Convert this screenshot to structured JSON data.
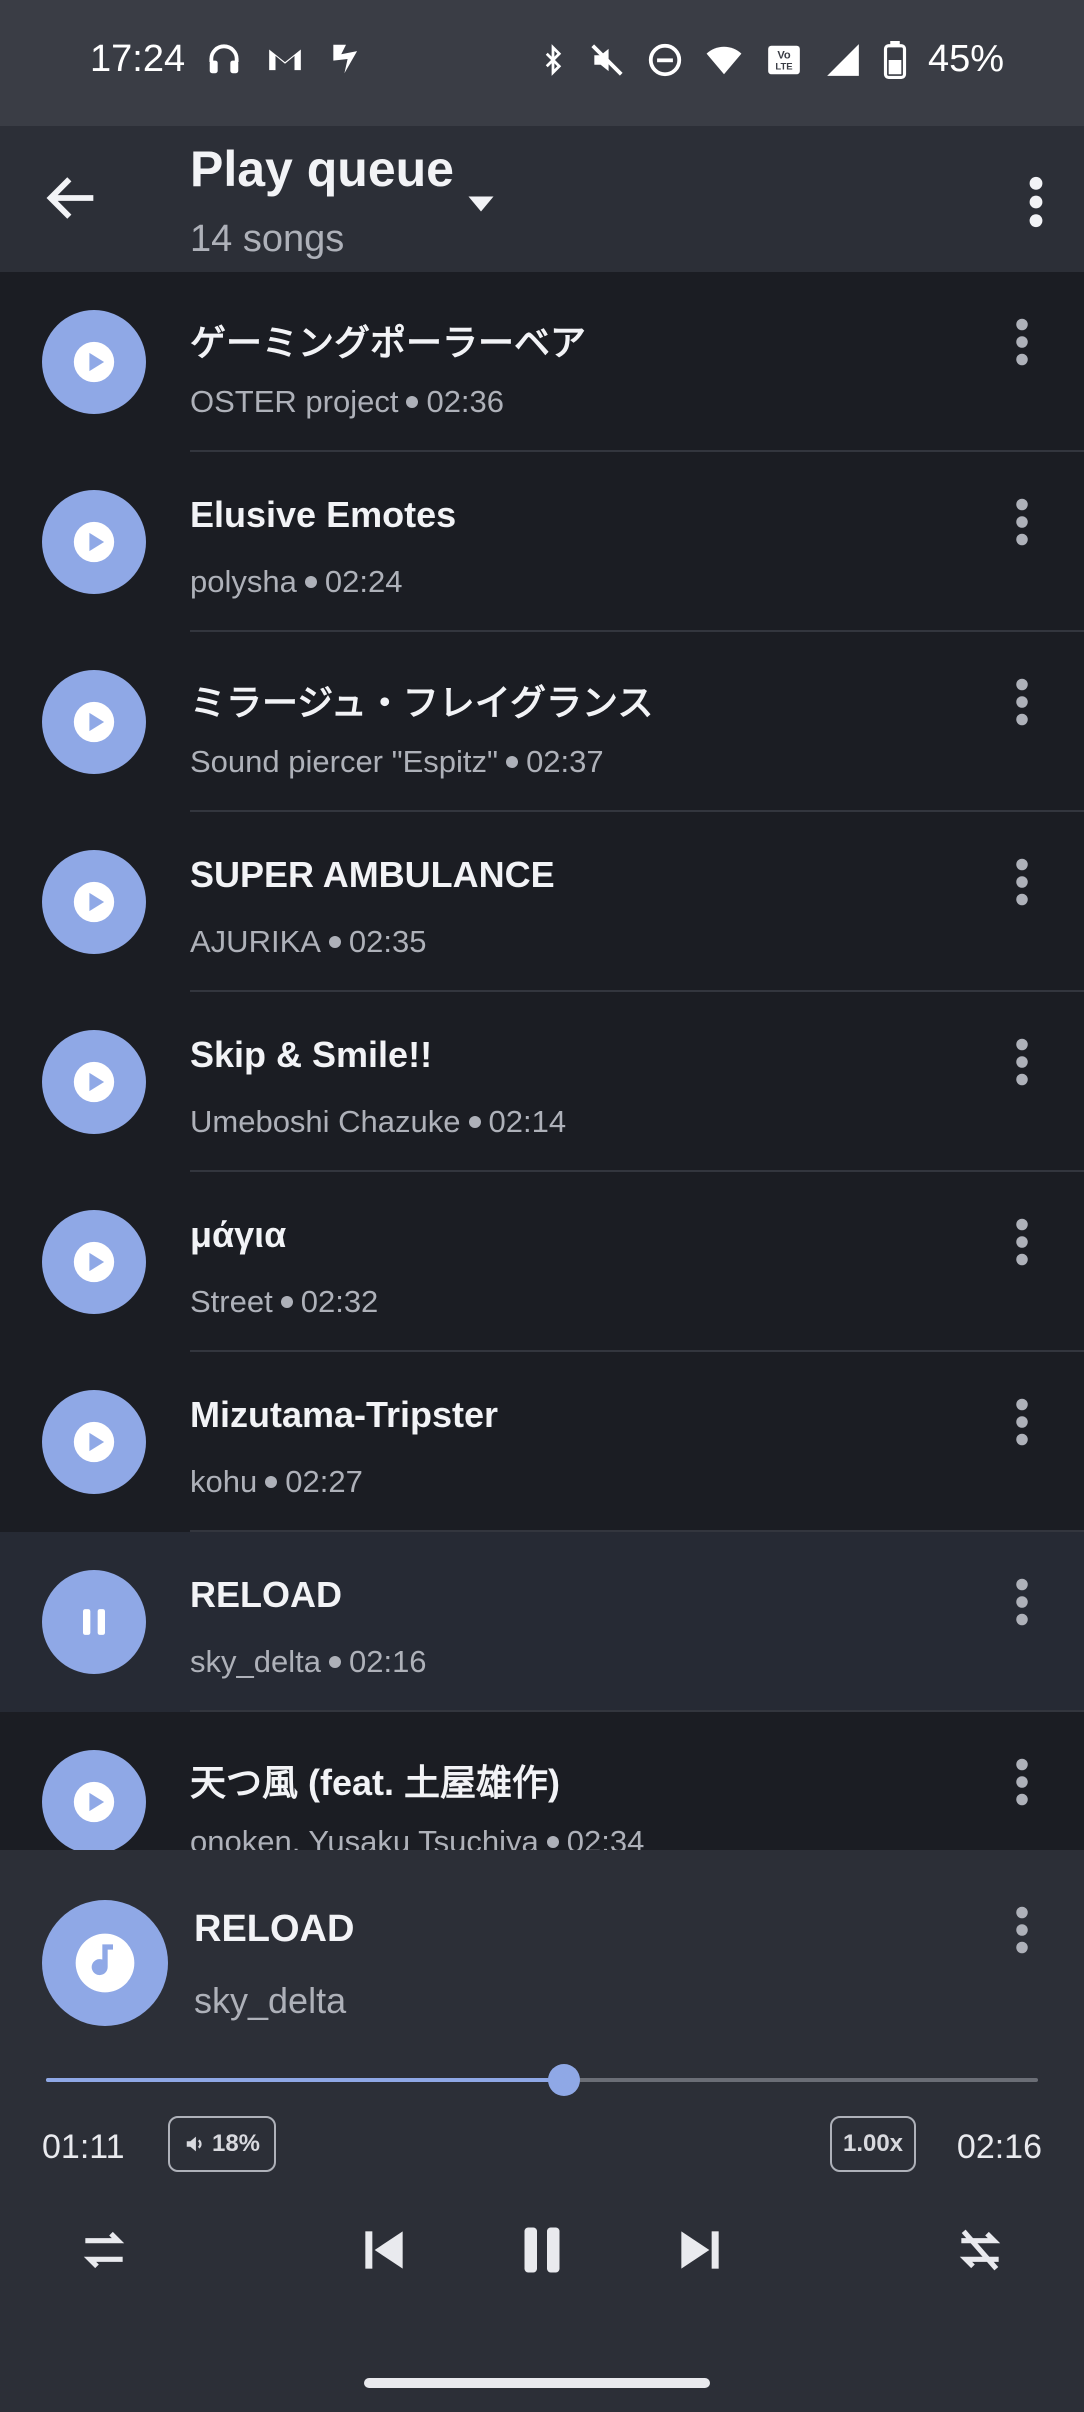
{
  "status_bar": {
    "time": "17:24",
    "battery": "45%",
    "left_icons": [
      "headphones-icon",
      "gmail-icon",
      "ticktick-icon"
    ],
    "right_icons": [
      "bluetooth-icon",
      "mute-icon",
      "dnd-icon",
      "wifi-icon",
      "volte-icon",
      "signal-icon",
      "battery-icon"
    ]
  },
  "app_bar": {
    "title": "Play queue",
    "subtitle": "14 songs"
  },
  "queue": [
    {
      "title": "ゲーミングポーラーベア",
      "artist": "OSTER project",
      "duration": "02:36",
      "state": "play"
    },
    {
      "title": "Elusive Emotes",
      "artist": "polysha",
      "duration": "02:24",
      "state": "play"
    },
    {
      "title": "ミラージュ・フレイグランス",
      "artist": "Sound piercer \"Espitz\"",
      "duration": "02:37",
      "state": "play"
    },
    {
      "title": "SUPER AMBULANCE",
      "artist": "AJURIKA",
      "duration": "02:35",
      "state": "play"
    },
    {
      "title": "Skip & Smile!!",
      "artist": "Umeboshi Chazuke",
      "duration": "02:14",
      "state": "play"
    },
    {
      "title": "μάγια",
      "artist": "Street",
      "duration": "02:32",
      "state": "play"
    },
    {
      "title": "Mizutama-Tripster",
      "artist": "kohu",
      "duration": "02:27",
      "state": "play"
    },
    {
      "title": "RELOAD",
      "artist": "sky_delta",
      "duration": "02:16",
      "state": "pause"
    },
    {
      "title": "天つ風 (feat. 土屋雄作)",
      "artist": "onoken, Yusaku Tsuchiya",
      "duration": "02:34",
      "state": "play"
    }
  ],
  "now_playing": {
    "title": "RELOAD",
    "artist": "sky_delta",
    "elapsed": "01:11",
    "total": "02:16",
    "progress_fraction": 0.522,
    "volume": "18%",
    "speed": "1.00x"
  },
  "colors": {
    "accent": "#8fa8e6",
    "background": "#1b1d23",
    "surface": "#2c2f37"
  }
}
